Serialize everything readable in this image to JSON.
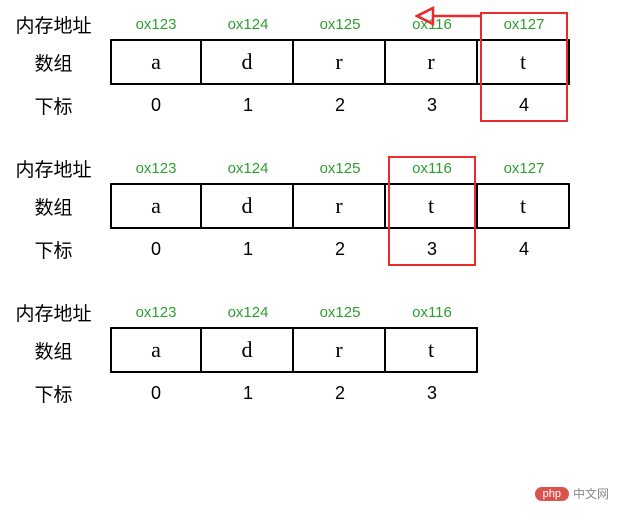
{
  "labels": {
    "address": "内存地址",
    "array": "数组",
    "index": "下标"
  },
  "diagrams": [
    {
      "addresses": [
        "ox123",
        "ox124",
        "ox125",
        "ox116",
        "ox127"
      ],
      "values": [
        "a",
        "d",
        "r",
        "r",
        "t"
      ],
      "indices": [
        "0",
        "1",
        "2",
        "3",
        "4"
      ],
      "highlight_index": 4,
      "arrow": true
    },
    {
      "addresses": [
        "ox123",
        "ox124",
        "ox125",
        "ox116",
        "ox127"
      ],
      "values": [
        "a",
        "d",
        "r",
        "t",
        "t"
      ],
      "indices": [
        "0",
        "1",
        "2",
        "3",
        "4"
      ],
      "highlight_index": 3,
      "arrow": false
    },
    {
      "addresses": [
        "ox123",
        "ox124",
        "ox125",
        "ox116"
      ],
      "values": [
        "a",
        "d",
        "r",
        "t"
      ],
      "indices": [
        "0",
        "1",
        "2",
        "3"
      ],
      "highlight_index": null,
      "arrow": false
    }
  ],
  "watermark": {
    "badge": "php",
    "text": "中文网"
  }
}
